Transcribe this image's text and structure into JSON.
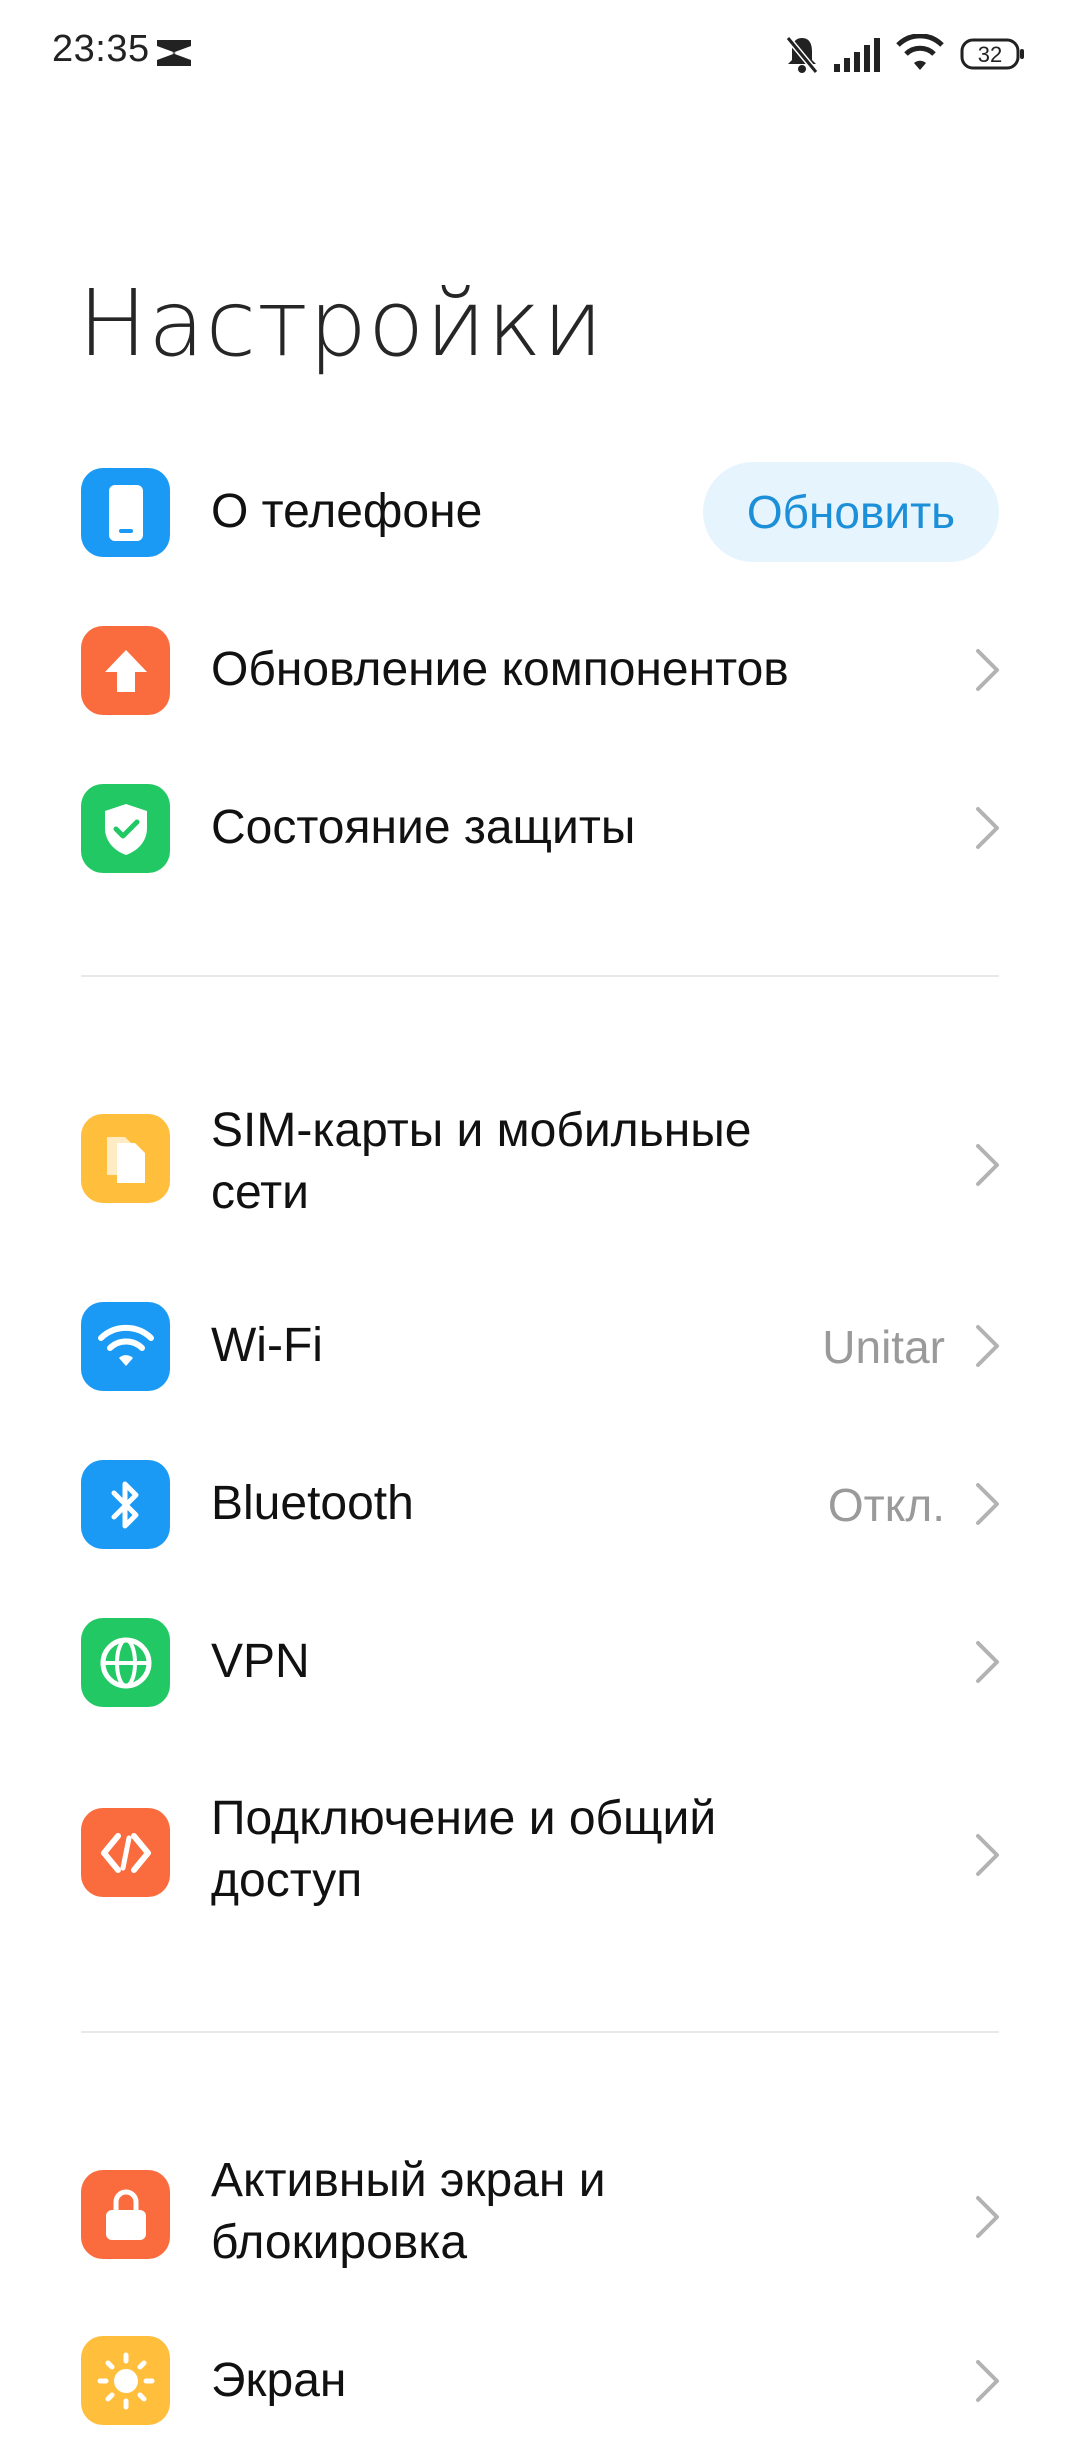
{
  "status_bar": {
    "time": "23:35",
    "battery_level": "32",
    "icons": [
      "notification-app-icon",
      "silent-bell-icon",
      "cell-signal-icon",
      "wifi-icon",
      "battery-icon"
    ]
  },
  "page": {
    "title": "Настройки"
  },
  "group1": {
    "about": {
      "label": "О телефоне",
      "button": "Обновить",
      "icon": "phone-icon",
      "color": "#1a9af5"
    },
    "components_update": {
      "label": "Обновление компонентов",
      "icon": "upload-arrow-icon",
      "color": "#fa6b3e"
    },
    "security_status": {
      "label": "Состояние защиты",
      "icon": "shield-check-icon",
      "color": "#21c864"
    }
  },
  "group2": {
    "sim": {
      "label_line1": "SIM-карты и мобильные",
      "label_line2": "сети",
      "icon": "sim-card-icon",
      "color": "#ffbe3c"
    },
    "wifi": {
      "label": "Wi-Fi",
      "value": "Unitar",
      "icon": "wifi-icon",
      "color": "#1a9af5"
    },
    "bluetooth": {
      "label": "Bluetooth",
      "value": "Откл.",
      "icon": "bluetooth-icon",
      "color": "#1a9af5"
    },
    "vpn": {
      "label": "VPN",
      "icon": "globe-icon",
      "color": "#21c864"
    },
    "sharing": {
      "label_line1": "Подключение и общий",
      "label_line2": "доступ",
      "icon": "connection-sharing-icon",
      "color": "#fa6b3e"
    }
  },
  "group3": {
    "lockscreen": {
      "label_line1": "Активный экран и",
      "label_line2": "блокировка",
      "icon": "lock-icon",
      "color": "#fa6b3e"
    },
    "display": {
      "label": "Экран",
      "icon": "sun-icon",
      "color": "#ffbe3c"
    }
  }
}
